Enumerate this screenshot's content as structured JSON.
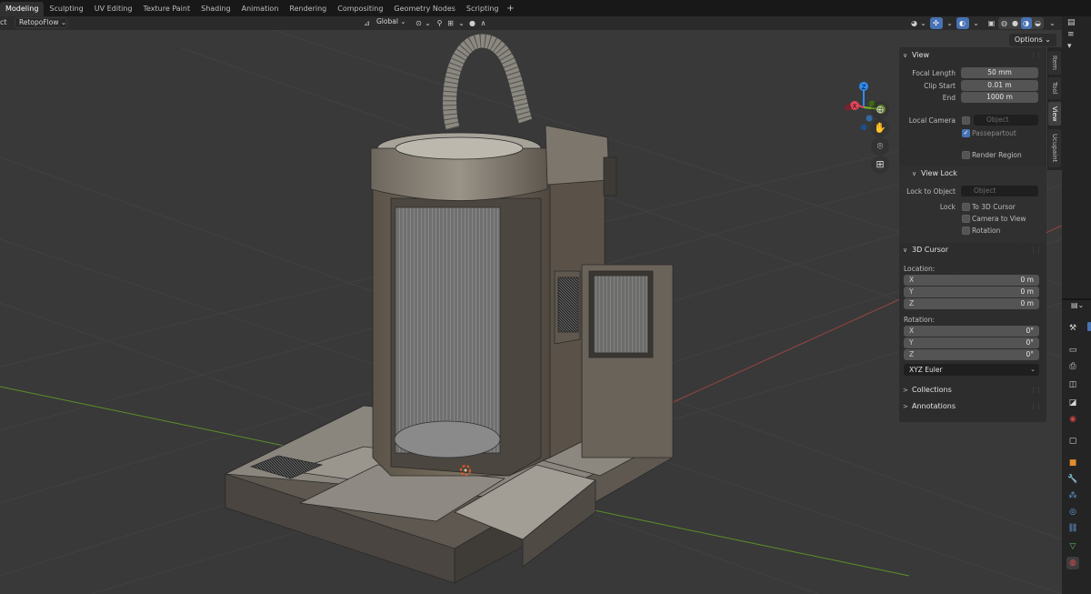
{
  "workspace_tabs": [
    "Modeling",
    "Sculpting",
    "UV Editing",
    "Texture Paint",
    "Shading",
    "Animation",
    "Rendering",
    "Compositing",
    "Geometry Nodes",
    "Scripting"
  ],
  "active_tab": "Modeling",
  "add_tab_symbol": "+",
  "header": {
    "left_text": "ct",
    "addon_menu": "RetopoFlow ⌄",
    "orientation": "Global ⌄"
  },
  "viewport": {
    "options_label": "Options ⌄",
    "background_color": "#393939",
    "axis_colors": {
      "x": "#b04a4a",
      "y": "#6a9a2a"
    },
    "gizmo": {
      "z": "Z",
      "y": "Y",
      "x": "X",
      "colors": {
        "x": "#e2455a",
        "y": "#79b626",
        "z": "#2d8cf0"
      }
    },
    "nav_icons": [
      "zoom-icon",
      "hand-pan-icon",
      "camera-icon",
      "grid-ortho-icon"
    ]
  },
  "npanel": {
    "tabs": [
      "Item",
      "Tool",
      "View",
      "Ucupaint"
    ],
    "active_tab": "View",
    "view": {
      "title": "View",
      "focal_length_label": "Focal Length",
      "focal_length": "50 mm",
      "clip_start_label": "Clip Start",
      "clip_start": "0.01 m",
      "end_label": "End",
      "end": "1000 m",
      "local_camera_label": "Local Camera",
      "local_camera_placeholder": "Object",
      "passepartout_label": "Passepartout",
      "render_region_label": "Render Region"
    },
    "view_lock": {
      "title": "View Lock",
      "lock_to_object_label": "Lock to Object",
      "lock_to_object_placeholder": "Object",
      "lock_label": "Lock",
      "to_3d_cursor": "To 3D Cursor",
      "camera_to_view": "Camera to View",
      "rotation": "Rotation"
    },
    "cursor": {
      "title": "3D Cursor",
      "location_label": "Location:",
      "location": [
        {
          "axis": "X",
          "value": "0 m"
        },
        {
          "axis": "Y",
          "value": "0 m"
        },
        {
          "axis": "Z",
          "value": "0 m"
        }
      ],
      "rotation_label": "Rotation:",
      "rotation": [
        {
          "axis": "X",
          "value": "0°"
        },
        {
          "axis": "Y",
          "value": "0°"
        },
        {
          "axis": "Z",
          "value": "0°"
        }
      ],
      "rotation_mode": "XYZ Euler"
    },
    "collections": "Collections",
    "annotations": "Annotations"
  },
  "properties_icons": [
    "tool-icon",
    "render-icon",
    "output-icon",
    "view-layer-icon",
    "scene-icon",
    "world-icon",
    "collection-icon",
    "object-icon",
    "modifier-icon",
    "particles-icon",
    "physics-icon",
    "constraints-icon",
    "data-icon",
    "material-icon"
  ]
}
